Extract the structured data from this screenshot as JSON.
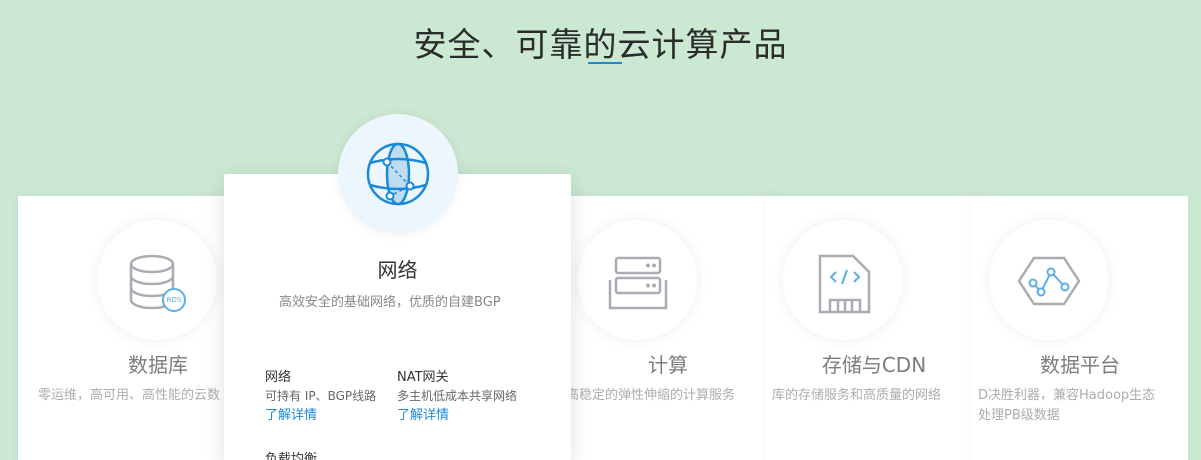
{
  "section": {
    "title": "安全、可靠的云计算产品"
  },
  "cards": {
    "database": {
      "title": "数据库",
      "desc": "零运维，高可用、高性能的云数",
      "badge": "RDS"
    },
    "network": {
      "title": "网络",
      "desc": "高效安全的基础网络，优质的自建BGP",
      "subs": [
        {
          "title": "网络",
          "desc": "可持有 IP、BGP线路",
          "link": "了解详情"
        },
        {
          "title": "NAT网关",
          "desc": "多主机低成本共享网络",
          "link": "了解详情"
        },
        {
          "title": "负载均衡"
        }
      ]
    },
    "compute": {
      "title": "计算",
      "desc": "高稳定的弹性伸缩的计算服务"
    },
    "storage": {
      "title": "存储与CDN",
      "desc": "库的存储服务和高质量的网络"
    },
    "platform": {
      "title": "数据平台",
      "desc1": "D决胜利器，兼容Hadoop生态",
      "desc2": "处理PB级数据"
    }
  },
  "colors": {
    "background": "#cbe8d2",
    "accent": "#1a8ad8"
  }
}
